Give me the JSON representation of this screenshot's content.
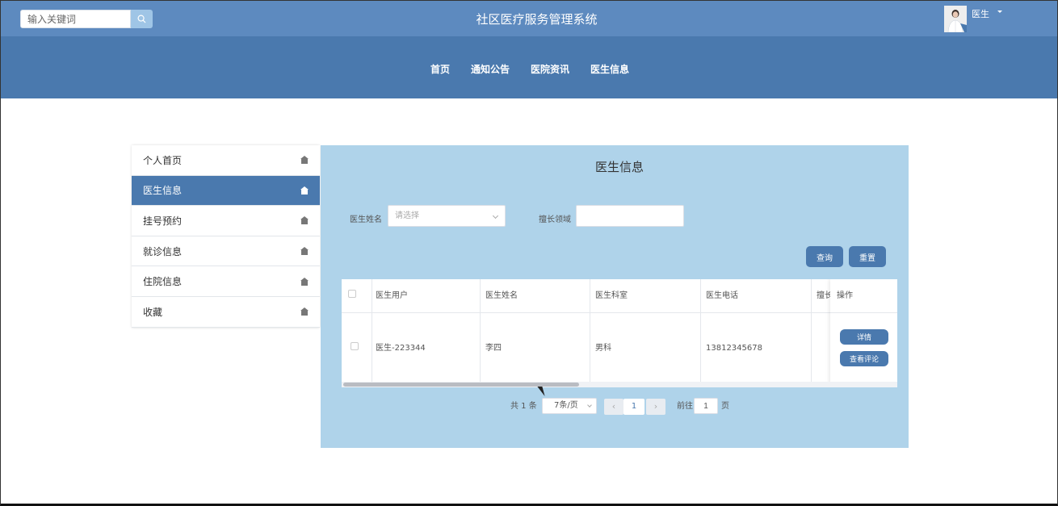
{
  "header": {
    "search_placeholder": "输入关键词",
    "title": "社区医疗服务管理系统",
    "user_name": "医生"
  },
  "nav": [
    "首页",
    "通知公告",
    "医院资讯",
    "医生信息"
  ],
  "sidebar": {
    "items": [
      {
        "label": "个人首页",
        "active": false
      },
      {
        "label": "医生信息",
        "active": true
      },
      {
        "label": "挂号预约",
        "active": false
      },
      {
        "label": "就诊信息",
        "active": false
      },
      {
        "label": "住院信息",
        "active": false
      },
      {
        "label": "收藏",
        "active": false
      }
    ]
  },
  "panel": {
    "title": "医生信息",
    "filters": {
      "doctor_name_label": "医生姓名",
      "doctor_name_placeholder": "请选择",
      "specialty_label": "擅长领域",
      "specialty_value": ""
    },
    "buttons": {
      "query": "查询",
      "reset": "重置"
    },
    "table": {
      "headers": [
        "医生用户",
        "医生姓名",
        "医生科室",
        "医生电话",
        "擅长",
        "操作"
      ],
      "rows": [
        {
          "user": "医生-223344",
          "name": "李四",
          "department": "男科",
          "phone": "13812345678",
          "specialty": ""
        }
      ],
      "row_actions": {
        "detail": "详情",
        "reviews": "查看评论"
      }
    },
    "pagination": {
      "total": "共 1 条",
      "page_size": "7条/页",
      "current_page": "1",
      "goto_label": "前往",
      "goto_value": "1",
      "page_suffix": "页",
      "prev_icon": "‹",
      "next_icon": "›"
    }
  },
  "colors": {
    "topbar": "#5d8abf",
    "navbar": "#4a79ae",
    "panel_bg": "#afd3ea",
    "accent": "#4a79ae"
  }
}
